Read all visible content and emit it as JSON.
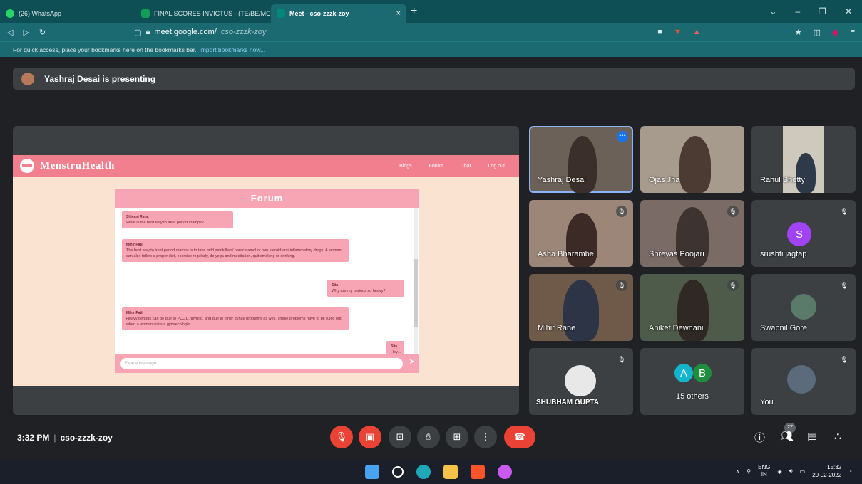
{
  "browser": {
    "tabs": [
      {
        "title": "(26) WhatsApp",
        "color": "#25d366"
      },
      {
        "title": "FINAL SCORES INVICTUS - (TE/BE/MC",
        "color": "#0f9d58"
      },
      {
        "title": "Meet - cso-zzzk-zoy",
        "color": "#00897b"
      }
    ],
    "tab_close": "×",
    "new_tab": "+",
    "url_host": "meet.google.com/",
    "url_path": "cso-zzzk-zoy",
    "bookmarks_text": "For quick access, place your bookmarks here on the bookmarks bar.",
    "bookmarks_link": "Import bookmarks now..."
  },
  "meet": {
    "presenting_text": "Yashraj Desai is presenting",
    "shared_screen": {
      "site_title": "MenstruHealth",
      "nav": [
        "Blogs",
        "Forum",
        "Chat",
        "Log out"
      ],
      "forum_title": "Forum",
      "messages": [
        {
          "author": "Shivani Rana",
          "text": "What is the best way to treat period cramps?"
        },
        {
          "author": "Mihir Patil",
          "text": "The best way to treat period cramps is to take mild painkillers/ paracetamol or non steroid anti-inflammatory drugs. A woman can also follow a proper diet, exercise regularly, do yoga and meditation, quit smoking or drinking."
        },
        {
          "author": "Sita",
          "text": "Why are my periods so heavy?"
        },
        {
          "author": "Mihir Patil",
          "text": "Heavy periods can be due to PCOD, thyroid, and due to other gynae problems as well. These problems have to be ruled out when a woman visits a gynaecologist."
        },
        {
          "author": "Sita",
          "text": "Hey..."
        }
      ],
      "input_placeholder": "Type a message",
      "send_icon": "➤"
    },
    "participants": [
      {
        "name": "Yashraj Desai"
      },
      {
        "name": "Ojas Jha"
      },
      {
        "name": "Rahul Shetty"
      },
      {
        "name": "Asha Bharambe"
      },
      {
        "name": "Shreyas Poojari"
      },
      {
        "name": "srushti jagtap",
        "initial": "S",
        "color": "#a142f4"
      },
      {
        "name": "Mihir Rane"
      },
      {
        "name": "Aniket Dewnani"
      },
      {
        "name": "Swapnil Gore"
      },
      {
        "name": "SHUBHAM GUPTA"
      },
      {
        "name": "15 others",
        "initials": [
          "A",
          "B"
        ],
        "colors": [
          "#12b5cb",
          "#1e8e3e"
        ]
      },
      {
        "name": "You"
      }
    ],
    "time": "3:32 PM",
    "separator": "|",
    "meeting_code": "cso-zzzk-zoy",
    "participant_count": "27"
  },
  "taskbar": {
    "lang_top": "ENG",
    "lang_bottom": "IN",
    "clock_time": "15:32",
    "clock_date": "20-02-2022"
  }
}
